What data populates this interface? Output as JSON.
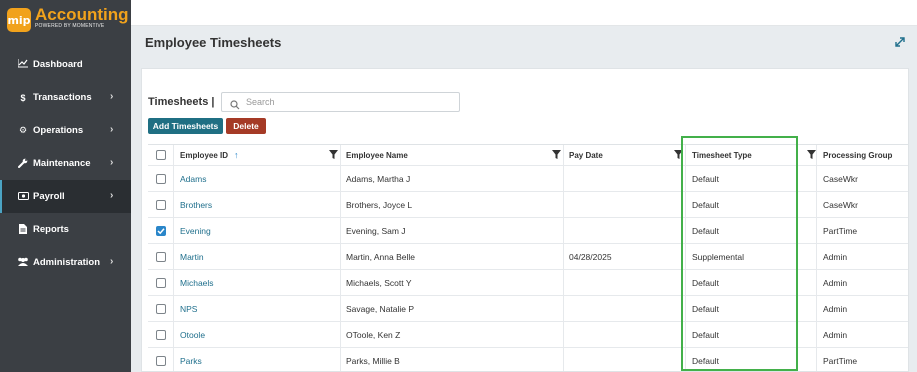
{
  "app": {
    "logo_mark": "mip",
    "logo_title": "Accounting",
    "logo_subtitle": "POWERED BY MOMENTIVE"
  },
  "sidebar": {
    "items": [
      {
        "label": "Dashboard",
        "icon": "chart-line-icon",
        "has_chevron": false,
        "active": false
      },
      {
        "label": "Transactions",
        "icon": "dollar-icon",
        "has_chevron": true,
        "active": false
      },
      {
        "label": "Operations",
        "icon": "gears-icon",
        "has_chevron": true,
        "active": false
      },
      {
        "label": "Maintenance",
        "icon": "wrench-icon",
        "has_chevron": true,
        "active": false
      },
      {
        "label": "Payroll",
        "icon": "money-bill-icon",
        "has_chevron": true,
        "active": true
      },
      {
        "label": "Reports",
        "icon": "file-icon",
        "has_chevron": false,
        "active": false
      },
      {
        "label": "Administration",
        "icon": "users-icon",
        "has_chevron": true,
        "active": false
      }
    ]
  },
  "header": {
    "title": "Employee Timesheets",
    "expand_icon": "expand-icon"
  },
  "panel": {
    "title": "Timesheets |",
    "search_placeholder": "Search",
    "add_label": "Add Timesheets",
    "delete_label": "Delete"
  },
  "table": {
    "columns": [
      "Employee ID",
      "Employee Name",
      "Pay Date",
      "Timesheet Type",
      "Processing Group"
    ],
    "sorted_column": "Employee ID",
    "rows": [
      {
        "id": "Adams",
        "name": "Adams, Martha J",
        "pay_date": "",
        "type": "Default",
        "group": "CaseWkr",
        "checked": false
      },
      {
        "id": "Brothers",
        "name": "Brothers, Joyce L",
        "pay_date": "",
        "type": "Default",
        "group": "CaseWkr",
        "checked": false
      },
      {
        "id": "Evening",
        "name": "Evening, Sam J",
        "pay_date": "",
        "type": "Default",
        "group": "PartTime",
        "checked": true
      },
      {
        "id": "Martin",
        "name": "Martin, Anna Belle",
        "pay_date": "04/28/2025",
        "type": "Supplemental",
        "group": "Admin",
        "checked": false
      },
      {
        "id": "Michaels",
        "name": "Michaels, Scott Y",
        "pay_date": "",
        "type": "Default",
        "group": "Admin",
        "checked": false
      },
      {
        "id": "NPS",
        "name": "Savage, Natalie P",
        "pay_date": "",
        "type": "Default",
        "group": "Admin",
        "checked": false
      },
      {
        "id": "Otoole",
        "name": "OToole, Ken Z",
        "pay_date": "",
        "type": "Default",
        "group": "Admin",
        "checked": false
      },
      {
        "id": "Parks",
        "name": "Parks, Millie B",
        "pay_date": "",
        "type": "Default",
        "group": "PartTime",
        "checked": false
      }
    ]
  },
  "colors": {
    "sidebar_bg": "#3b3f44",
    "brand": "#f1a21c",
    "link": "#1f6f8c",
    "add_button": "#1f6f83",
    "delete_button": "#a53a26",
    "highlight": "#43b04a",
    "checkbox_checked": "#2a86c9"
  }
}
